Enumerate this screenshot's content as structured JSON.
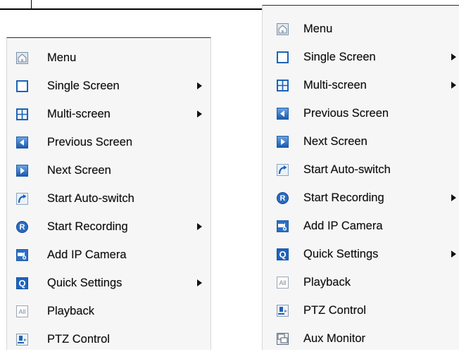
{
  "menu_left": {
    "items": [
      {
        "label": "Menu",
        "icon": "home-menu-icon",
        "submenu": false
      },
      {
        "label": "Single Screen",
        "icon": "single-screen-icon",
        "submenu": true
      },
      {
        "label": "Multi-screen",
        "icon": "multi-screen-icon",
        "submenu": true
      },
      {
        "label": "Previous Screen",
        "icon": "previous-screen-icon",
        "submenu": false
      },
      {
        "label": "Next Screen",
        "icon": "next-screen-icon",
        "submenu": false
      },
      {
        "label": "Start Auto-switch",
        "icon": "auto-switch-icon",
        "submenu": false
      },
      {
        "label": "Start Recording",
        "icon": "recording-icon",
        "submenu": true
      },
      {
        "label": "Add IP Camera",
        "icon": "add-ip-camera-icon",
        "submenu": false
      },
      {
        "label": "Quick Settings",
        "icon": "quick-settings-icon",
        "submenu": true
      },
      {
        "label": "Playback",
        "icon": "playback-icon",
        "submenu": false
      },
      {
        "label": "PTZ Control",
        "icon": "ptz-control-icon",
        "submenu": false
      }
    ]
  },
  "menu_right": {
    "items": [
      {
        "label": "Menu",
        "icon": "home-menu-icon",
        "submenu": false
      },
      {
        "label": "Single Screen",
        "icon": "single-screen-icon",
        "submenu": true
      },
      {
        "label": "Multi-screen",
        "icon": "multi-screen-icon",
        "submenu": true
      },
      {
        "label": "Previous Screen",
        "icon": "previous-screen-icon",
        "submenu": false
      },
      {
        "label": "Next Screen",
        "icon": "next-screen-icon",
        "submenu": false
      },
      {
        "label": "Start Auto-switch",
        "icon": "auto-switch-icon",
        "submenu": false
      },
      {
        "label": "Start Recording",
        "icon": "recording-icon",
        "submenu": true
      },
      {
        "label": "Add IP Camera",
        "icon": "add-ip-camera-icon",
        "submenu": false
      },
      {
        "label": "Quick Settings",
        "icon": "quick-settings-icon",
        "submenu": true
      },
      {
        "label": "Playback",
        "icon": "playback-icon",
        "submenu": false
      },
      {
        "label": "PTZ Control",
        "icon": "ptz-control-icon",
        "submenu": false
      },
      {
        "label": "Aux Monitor",
        "icon": "aux-monitor-icon",
        "submenu": false
      }
    ]
  },
  "colors": {
    "menu_background": "#f6f6f6",
    "icon_blue": "#1c63b7",
    "text": "#121212"
  }
}
